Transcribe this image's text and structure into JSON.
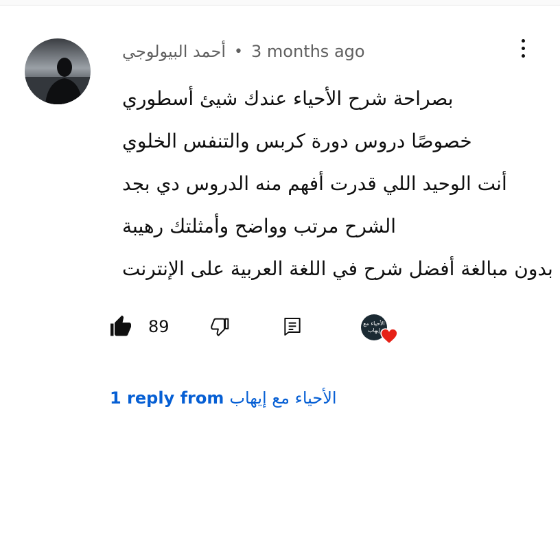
{
  "comment": {
    "author": "أحمد البيولوجي",
    "separator": "•",
    "timestamp": "3 months ago",
    "lines": [
      "بصراحة شرح الأحياء عندك شيئ أسطوري",
      "خصوصًا دروس دورة كربس والتنفس الخلوي",
      "أنت الوحيد اللي قدرت أفهم منه الدروس دي بجد",
      "الشرح مرتب وواضح وأمثلتك رهيبة",
      "بدون مبالغة أفضل شرح في اللغة العربية على الإنترنت"
    ]
  },
  "actions": {
    "like_count": "89",
    "like_icon": "thumbs-up-filled-icon",
    "dislike_icon": "thumbs-down-icon",
    "reply_icon": "reply-comment-icon",
    "creator_heart": {
      "badge_text": "الأحياء مع إيهاب",
      "heart_color": "#e62117"
    }
  },
  "replies": {
    "prefix": "1 reply from",
    "channel": "الأحياء مع إيهاب",
    "color": "#065fd4"
  }
}
